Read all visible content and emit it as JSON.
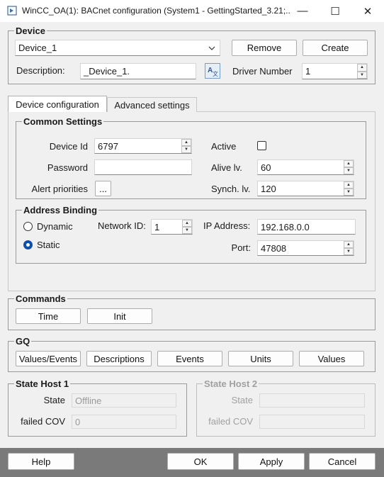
{
  "window": {
    "title": "WinCC_OA(1): BACnet configuration (System1 - GettingStarted_3.21;...",
    "minimize": "—",
    "maximize": "☐",
    "close": "✕"
  },
  "device": {
    "group_title": "Device",
    "selected": "Device_1",
    "remove_label": "Remove",
    "create_label": "Create",
    "description_label": "Description:",
    "description_value": "_Device_1.",
    "driver_number_label": "Driver Number",
    "driver_number_value": "1"
  },
  "tabs": [
    {
      "label": "Device configuration",
      "active": true
    },
    {
      "label": "Advanced settings",
      "active": false
    }
  ],
  "common": {
    "group_title": "Common Settings",
    "device_id_label": "Device Id",
    "device_id_value": "6797",
    "password_label": "Password",
    "password_value": "",
    "alert_label": "Alert priorities",
    "alert_button": "...",
    "active_label": "Active",
    "active_checked": false,
    "alive_label": "Alive lv.",
    "alive_value": "60",
    "synch_label": "Synch. lv.",
    "synch_value": "120"
  },
  "address": {
    "group_title": "Address Binding",
    "dynamic_label": "Dynamic",
    "static_label": "Static",
    "selected": "Static",
    "network_label": "Network ID:",
    "network_value": "1",
    "ip_label": "IP Address:",
    "ip_value": "192.168.0.0",
    "port_label": "Port:",
    "port_value": "47808"
  },
  "commands": {
    "group_title": "Commands",
    "time_label": "Time",
    "init_label": "Init"
  },
  "gq": {
    "group_title": "GQ",
    "buttons": [
      "Values/Events",
      "Descriptions",
      "Events",
      "Units",
      "Values"
    ]
  },
  "state_host_1": {
    "group_title": "State Host 1",
    "state_label": "State",
    "state_value": "Offline",
    "failed_label": "failed COV",
    "failed_value": "0"
  },
  "state_host_2": {
    "group_title": "State Host 2",
    "state_label": "State",
    "state_value": "",
    "failed_label": "failed COV",
    "failed_value": ""
  },
  "footer": {
    "help_label": "Help",
    "ok_label": "OK",
    "apply_label": "Apply",
    "cancel_label": "Cancel"
  }
}
